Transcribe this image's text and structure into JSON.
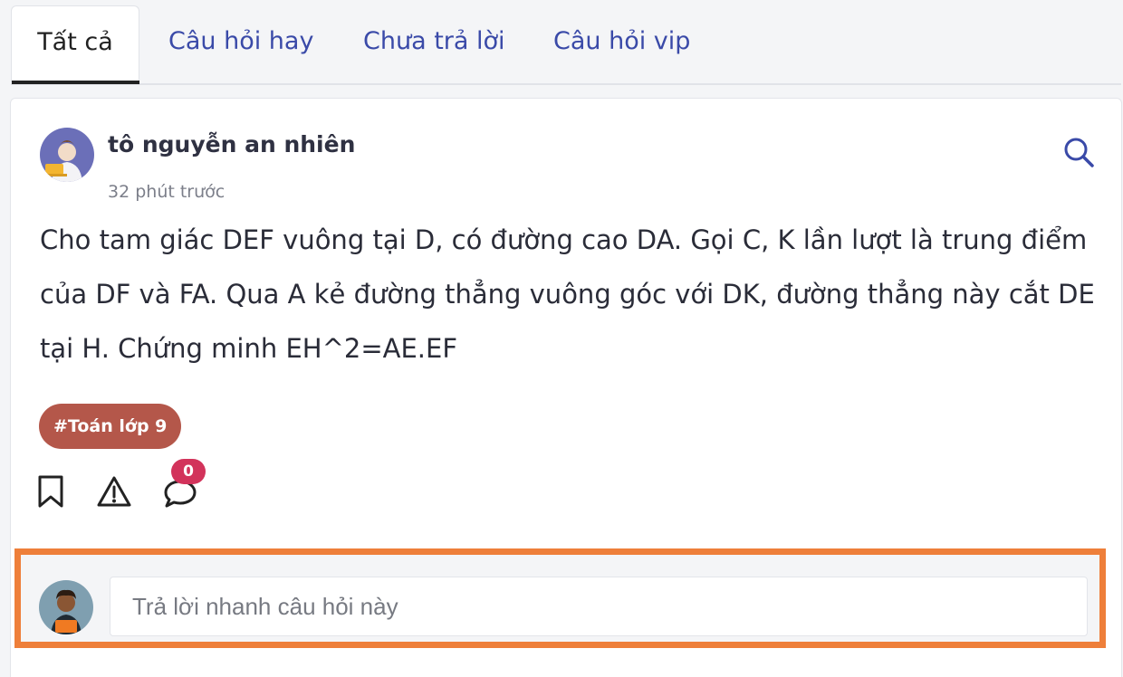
{
  "tabs": [
    {
      "label": "Tất cả",
      "active": true
    },
    {
      "label": "Câu hỏi hay",
      "active": false
    },
    {
      "label": "Chưa trả lời",
      "active": false
    },
    {
      "label": "Câu hỏi vip",
      "active": false
    }
  ],
  "post": {
    "author": "tô nguyễn an nhiên",
    "time": "32 phút trước",
    "question": "Cho tam giác DEF vuông tại D, có đường cao DA. Gọi C, K lần lượt là trung điểm của DF và FA. Qua A kẻ đường thẳng vuông góc với DK, đường thẳng này cắt DE tại H. Chứng minh EH^2=AE.EF",
    "tag": "#Toán lớp 9",
    "comment_count": "0"
  },
  "reply": {
    "placeholder": "Trả lời nhanh câu hỏi này"
  },
  "colors": {
    "tab_link": "#3a4aa8",
    "tag_bg": "#b4574a",
    "badge_bg": "#d2335b",
    "highlight_border": "#ee7f3a"
  },
  "icons": [
    "search-icon",
    "bookmark-icon",
    "warning-icon",
    "comment-icon"
  ]
}
